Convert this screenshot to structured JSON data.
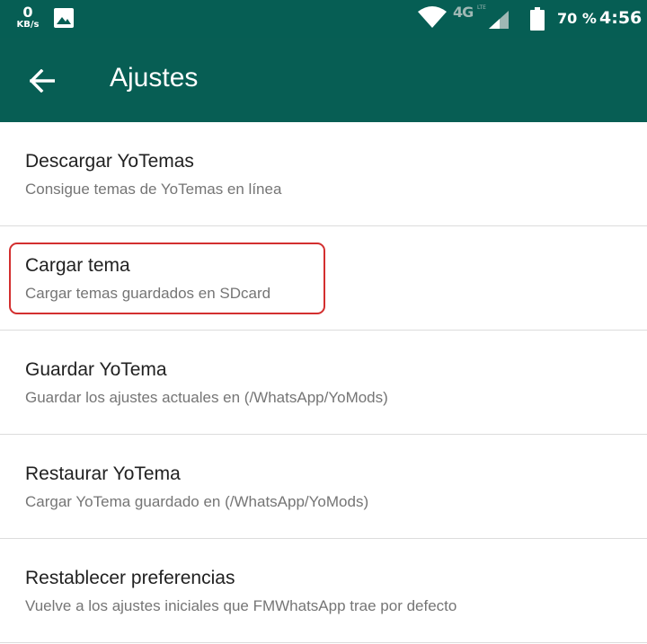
{
  "status_bar": {
    "speed_value": "0",
    "speed_unit": "KB/s",
    "network": "4G",
    "network_sub": "LTE",
    "battery": "70 %",
    "time": "4:56",
    "icons": [
      "gallery-icon",
      "wifi-icon",
      "signal-icon",
      "battery-icon"
    ]
  },
  "app_bar": {
    "title": "Ajustes",
    "back_icon": "arrow-back-icon"
  },
  "settings": [
    {
      "title": "Descargar YoTemas",
      "summary": "Consigue temas de YoTemas en línea"
    },
    {
      "title": "Cargar tema",
      "summary": "Cargar temas guardados en SDcard"
    },
    {
      "title": "Guardar YoTema",
      "summary": "Guardar los ajustes actuales en (/WhatsApp/YoMods)"
    },
    {
      "title": "Restaurar YoTema",
      "summary": "Cargar YoTema guardado en (/WhatsApp/YoMods)"
    },
    {
      "title": "Restablecer preferencias",
      "summary": "Vuelve a los ajustes iniciales que FMWhatsApp trae por defecto"
    }
  ],
  "colors": {
    "app_bar": "#075e54",
    "highlight": "#d32f2f",
    "title_text": "#212121",
    "summary_text": "#757575"
  }
}
